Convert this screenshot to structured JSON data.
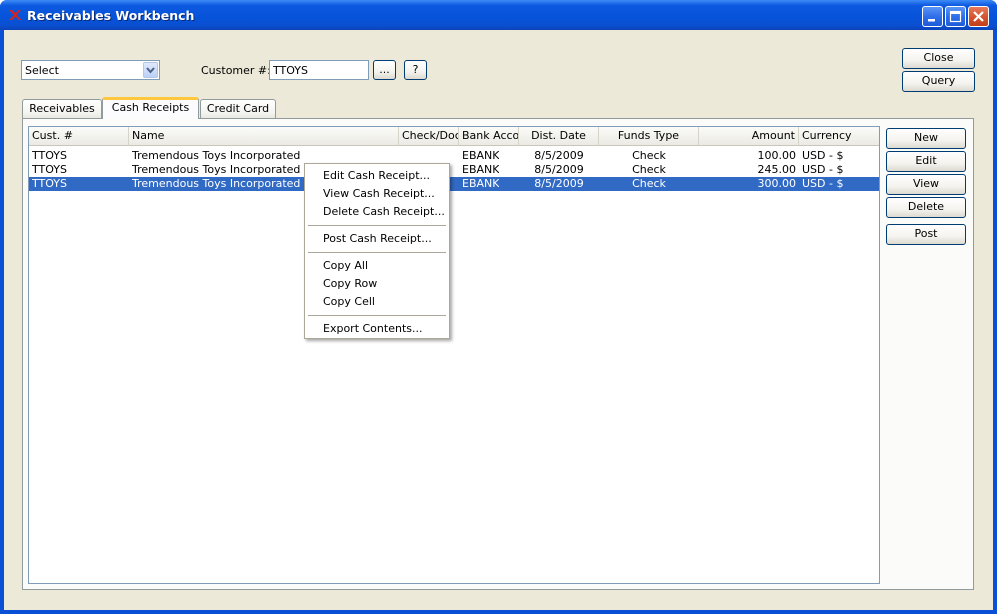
{
  "window": {
    "title": "Receivables Workbench"
  },
  "filter": {
    "selector_value": "Select",
    "customer_label": "Customer #:",
    "customer_value": "TTOYS",
    "lookup_label": "...",
    "help_label": "?"
  },
  "actions": {
    "close": "Close",
    "query": "Query"
  },
  "tabs": [
    {
      "label": "Receivables"
    },
    {
      "label": "Cash Receipts"
    },
    {
      "label": "Credit Card"
    }
  ],
  "table": {
    "columns": [
      "Cust. #",
      "Name",
      "Check/Doc",
      "Bank Accou",
      "Dist. Date",
      "Funds Type",
      "Amount",
      "Currency"
    ],
    "rows": [
      {
        "cust": "TTOYS",
        "name": "Tremendous Toys Incorporated",
        "check": "",
        "bank": "EBANK",
        "date": "8/5/2009",
        "funds": "Check",
        "amount": "100.00",
        "currency": "USD - $"
      },
      {
        "cust": "TTOYS",
        "name": "Tremendous Toys Incorporated",
        "check": "",
        "bank": "EBANK",
        "date": "8/5/2009",
        "funds": "Check",
        "amount": "245.00",
        "currency": "USD - $"
      },
      {
        "cust": "TTOYS",
        "name": "Tremendous Toys Incorporated",
        "check": "",
        "bank": "EBANK",
        "date": "8/5/2009",
        "funds": "Check",
        "amount": "300.00",
        "currency": "USD - $"
      }
    ]
  },
  "side_buttons": {
    "new": "New",
    "edit": "Edit",
    "view": "View",
    "delete": "Delete",
    "post": "Post"
  },
  "context_menu": {
    "edit": "Edit Cash Receipt...",
    "view": "View Cash Receipt...",
    "delete": "Delete Cash Receipt...",
    "post": "Post Cash Receipt...",
    "copy_all": "Copy All",
    "copy_row": "Copy Row",
    "copy_cell": "Copy Cell",
    "export": "Export Contents..."
  },
  "colors": {
    "titlebar": "#0a50d6",
    "selection": "#316ac5",
    "client": "#ece9d8",
    "tab_highlight": "#ffc83c"
  },
  "icons": [
    "xtuple-app-icon",
    "minimize-icon",
    "maximize-icon",
    "close-icon",
    "dropdown-arrow-icon"
  ]
}
